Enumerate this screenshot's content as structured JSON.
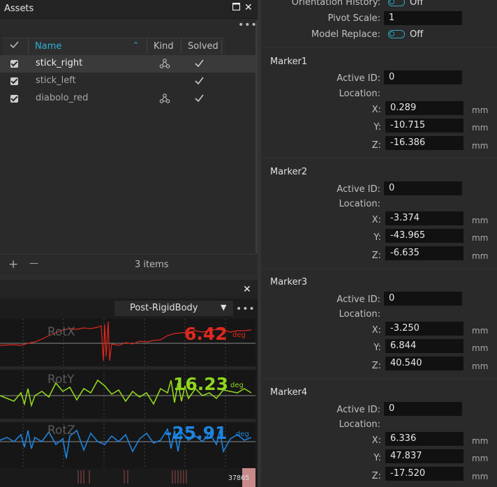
{
  "assets": {
    "title": "Assets",
    "columns": {
      "name": "Name",
      "kind": "Kind",
      "solved": "Solved"
    },
    "rows": [
      {
        "name": "stick_right",
        "checked": true,
        "kind_icon": "rigid-body-icon",
        "solved": true
      },
      {
        "name": "stick_left",
        "checked": true,
        "kind_icon": "rigid-body-icon",
        "solved": true
      },
      {
        "name": "diabolo_red",
        "checked": true,
        "kind_icon": "rigid-body-icon",
        "solved": true
      }
    ],
    "footer": {
      "add": "+",
      "remove": "—",
      "count": "3 items"
    }
  },
  "graph": {
    "source_dropdown": "Post-RigidBody",
    "channels": [
      {
        "label": "RotX",
        "value": "6.42",
        "unit": "deg",
        "color": "#e0281e"
      },
      {
        "label": "RotY",
        "value": "16.23",
        "unit": "deg",
        "color": "#8fd61c"
      },
      {
        "label": "RotZ",
        "value": "-25.91",
        "unit": "deg",
        "color": "#1d84e0"
      }
    ],
    "frame": "37865"
  },
  "properties": {
    "orientation_history": {
      "label": "Orientation History:",
      "value": "Off"
    },
    "pivot_scale": {
      "label": "Pivot Scale:",
      "value": "1"
    },
    "model_replace": {
      "label": "Model Replace:",
      "value": "Off"
    },
    "markers": [
      {
        "title": "Marker1",
        "active_id_label": "Active ID:",
        "active_id": "0",
        "location_label": "Location:",
        "x": "0.289",
        "y": "-10.715",
        "z": "-16.386"
      },
      {
        "title": "Marker2",
        "active_id_label": "Active ID:",
        "active_id": "0",
        "location_label": "Location:",
        "x": "-3.374",
        "y": "-43.965",
        "z": "-6.635"
      },
      {
        "title": "Marker3",
        "active_id_label": "Active ID:",
        "active_id": "0",
        "location_label": "Location:",
        "x": "-3.250",
        "y": "6.844",
        "z": "40.540"
      },
      {
        "title": "Marker4",
        "active_id_label": "Active ID:",
        "active_id": "0",
        "location_label": "Location:",
        "x": "6.336",
        "y": "47.837",
        "z": "-17.520"
      }
    ],
    "axis_labels": {
      "x": "X:",
      "y": "Y:",
      "z": "Z:"
    },
    "unit": "mm"
  },
  "colors": {
    "accent": "#2fa7c9",
    "selected_row": "#3a3a3a"
  }
}
